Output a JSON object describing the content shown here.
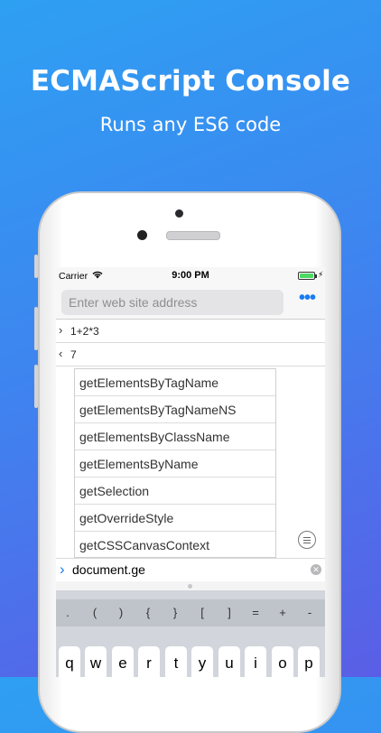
{
  "headline": "ECMAScript Console",
  "subline": "Runs any ES6 code",
  "status": {
    "carrier": "Carrier",
    "time": "9:00 PM",
    "battery_level": 1.0
  },
  "url": {
    "placeholder": "Enter web site address",
    "more_icon": "ellipsis-icon"
  },
  "console": [
    {
      "marker": "›",
      "text": "1+2*3"
    },
    {
      "marker": "‹",
      "text": "7"
    }
  ],
  "suggestions": [
    "getElementsByTagName",
    "getElementsByTagNameNS",
    "getElementsByClassName",
    "getElementsByName",
    "getSelection",
    "getOverrideStyle",
    "getCSSCanvasContext"
  ],
  "input": {
    "prompt": "›",
    "value": "document.ge"
  },
  "keyboard": {
    "symbols": [
      ".",
      "(",
      ")",
      "{",
      "}",
      "[",
      "]",
      "=",
      "+",
      "-"
    ],
    "letters": [
      "q",
      "w",
      "e",
      "r",
      "t",
      "y",
      "u",
      "i",
      "o",
      "p"
    ]
  },
  "colors": {
    "accent": "#1a7cf2",
    "bg_top": "#2ea0f2",
    "bg_bottom": "#5a5ee6"
  }
}
